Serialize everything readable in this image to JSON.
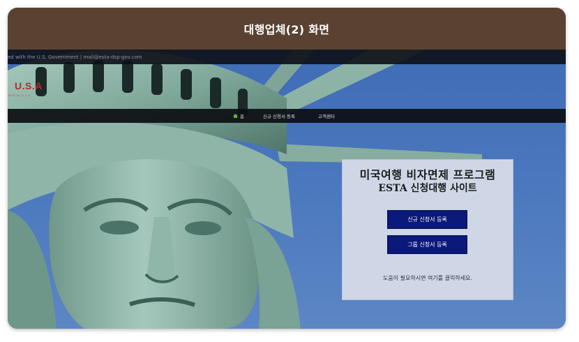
{
  "card": {
    "title": "대행업체(2) 화면"
  },
  "site": {
    "topbar_text": "ed with the U.S. Government  |  mail@esta-dsp-gov.com",
    "logo": "U.S.A",
    "logo_sub": "Services for U.S.",
    "nav": [
      {
        "label": "홈",
        "icon": "home-icon"
      },
      {
        "label": "신규 신청서 등록"
      },
      {
        "label": "고객센터"
      }
    ],
    "panel": {
      "title_line1": "미국여행 비자면제 프로그램",
      "title_line2": "ESTA 신청대행 사이트",
      "new_button": "신규 신청서 등록",
      "group_button": "그룹 신청서 등록",
      "help_text": "도움이 필요하시면 여기를 클릭하세요."
    }
  },
  "colors": {
    "header_bg": "#5a4232",
    "sky": "#4a77bd",
    "statue": "#7fa89b",
    "logo": "#c8222c",
    "button": "#0b197a",
    "panel_bg": "#cfd7e7"
  }
}
